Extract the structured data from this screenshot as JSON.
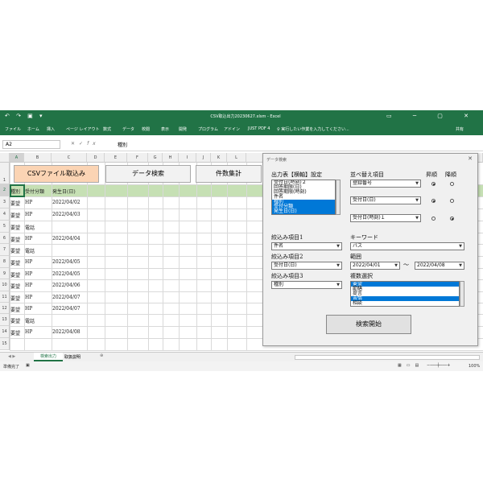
{
  "app": {
    "window_title": "CSV取込出力20230627.xlsm - Excel",
    "ribbon_tabs": [
      "ファイル",
      "ホーム",
      "挿入",
      "ページ レイアウト",
      "数式",
      "データ",
      "校閲",
      "表示",
      "開発",
      "プログラム",
      "アドイン",
      "JUST PDF 4"
    ],
    "tell_me": "実行したい作業を入力してください...",
    "share": "共有"
  },
  "formula_bar": {
    "name_box": "A2",
    "fx": "fx",
    "value": "種別"
  },
  "columns": [
    "A",
    "B",
    "C",
    "D",
    "E",
    "F",
    "G",
    "H",
    "I",
    "J",
    "K",
    "L"
  ],
  "rows": [
    "1",
    "2",
    "3",
    "4",
    "5",
    "6",
    "7",
    "8",
    "9",
    "10",
    "11",
    "12",
    "13",
    "14",
    "15"
  ],
  "sheet_buttons": {
    "csv_import": "CSVファイル取込み",
    "data_search": "データ検索",
    "count_sum": "件数集計"
  },
  "table": {
    "headers": [
      "種別",
      "受付分類",
      "発生日(日)"
    ],
    "rows": [
      [
        "要望",
        "HP",
        "2022/04/02"
      ],
      [
        "要望",
        "HP",
        "2022/04/03"
      ],
      [
        "要望",
        "電話",
        ""
      ],
      [
        "要望",
        "HP",
        "2022/04/04"
      ],
      [
        "要望",
        "電話",
        ""
      ],
      [
        "要望",
        "HP",
        "2022/04/05"
      ],
      [
        "要望",
        "HP",
        "2022/04/05"
      ],
      [
        "要望",
        "HP",
        "2022/04/06"
      ],
      [
        "要望",
        "HP",
        "2022/04/07"
      ],
      [
        "要望",
        "HP",
        "2022/04/07"
      ],
      [
        "要望",
        "電話",
        ""
      ],
      [
        "要望",
        "HP",
        "2022/04/08"
      ]
    ]
  },
  "sheet_tabs": [
    "検索出力",
    "取扱説明"
  ],
  "status": {
    "ready": "準備完了",
    "zoom": "100%"
  },
  "dialog": {
    "title": "データ検索",
    "output_label": "出力表【横軸】設定",
    "output_items": [
      "受付日(時刻)２",
      "回答期限(日)",
      "回答期限(時刻)",
      "件名",
      "種別",
      "受付分類",
      "発生日(日)"
    ],
    "output_selected": [
      4,
      5,
      6
    ],
    "sort_label": "並べ替え項目",
    "asc_label": "昇順",
    "desc_label": "降順",
    "sort_fields": [
      "登録番号",
      "受付日(日)",
      "受付日(時刻)１"
    ],
    "sort_order": [
      "asc",
      "asc",
      "desc"
    ],
    "filter1_label": "絞込み項目1",
    "filter1_value": "件名",
    "keyword_label": "キーワード",
    "keyword_value": "パス",
    "filter2_label": "絞込み項目2",
    "filter2_value": "受付日(日)",
    "range_label": "範囲",
    "range_from": "2022/04/01",
    "range_sep": "〜",
    "range_to": "2022/04/08",
    "filter3_label": "絞込み項目3",
    "filter3_value": "種別",
    "multi_label": "複数選択",
    "multi_items": [
      "要望",
      "節繕",
      "提言",
      "苦情",
      "相談"
    ],
    "multi_selected": [
      0,
      3
    ],
    "start_button": "検索開始"
  }
}
